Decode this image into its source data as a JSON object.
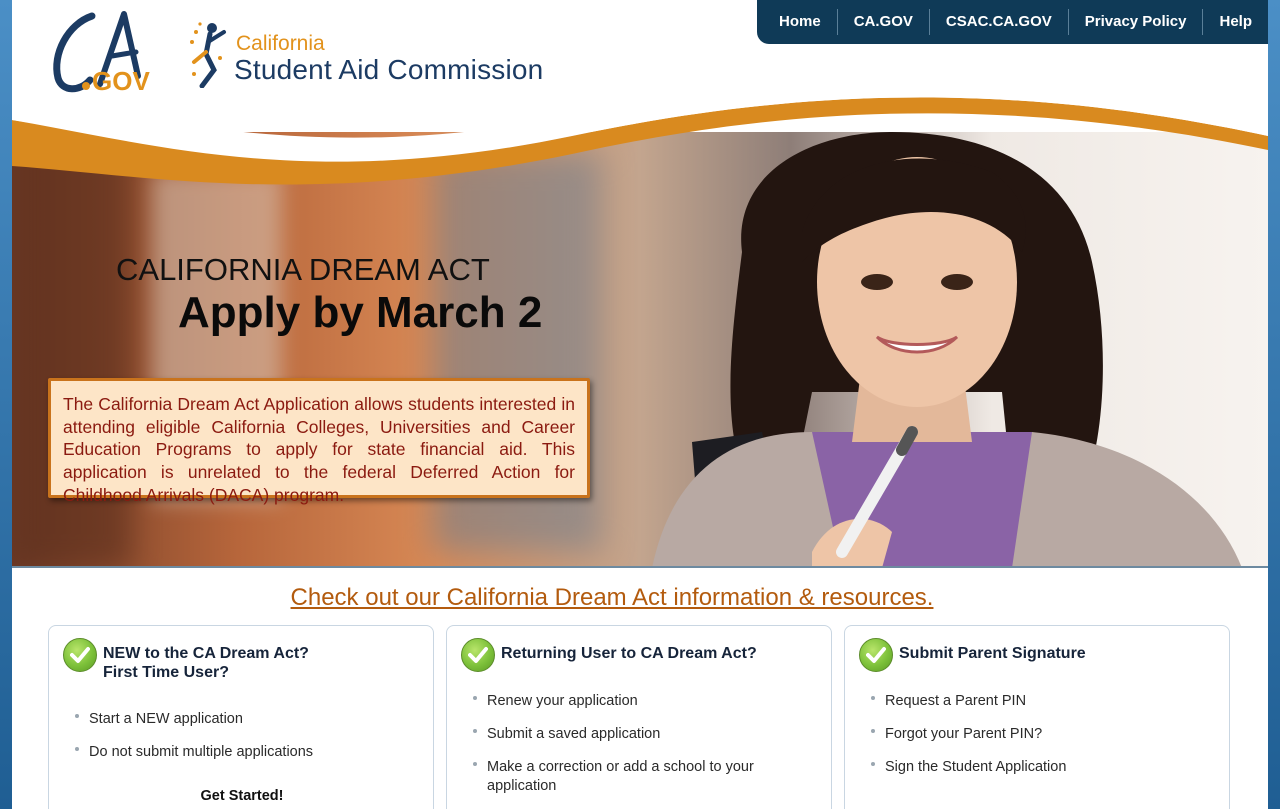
{
  "nav": {
    "items": [
      "Home",
      "CA.GOV",
      "CSAC.CA.GOV",
      "Privacy Policy",
      "Help"
    ]
  },
  "logos": {
    "ca_gov": "CA.GOV",
    "csac_line1": "California",
    "csac_line2": "Student Aid Commission"
  },
  "hero": {
    "title_small": "CALIFORNIA DREAM ACT",
    "title_large": "Apply by March 2",
    "description": "The California Dream Act Application allows students interested in attending eligible California Colleges, Universities and Career Education Programs to apply for state financial aid. This application is unrelated to the federal Deferred Action for Childhood Arrivals (DACA) program."
  },
  "resources_link": "Check out our California Dream Act information & resources.",
  "cards": [
    {
      "title_line1": "NEW to the CA Dream Act?",
      "title_line2": "First Time User?",
      "items": [
        "Start a NEW application",
        "Do not submit multiple applications"
      ],
      "cta": "Get Started!"
    },
    {
      "title_line1": "Returning User to CA Dream Act?",
      "items": [
        "Renew your application",
        "Submit a saved application",
        "Make a correction or add a school to your application"
      ]
    },
    {
      "title_line1": "Submit Parent Signature",
      "items": [
        "Request a Parent PIN",
        "Forgot your Parent PIN?",
        "Sign the Student Application"
      ]
    }
  ],
  "colors": {
    "nav_bg": "#0f3a57",
    "accent_orange": "#e2921c",
    "link": "#b35b0e",
    "box_text": "#8b1a10"
  }
}
